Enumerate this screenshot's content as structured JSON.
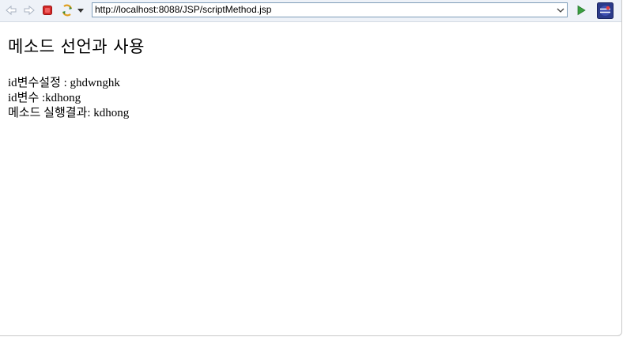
{
  "toolbar": {
    "back_icon": "back-arrow-icon",
    "forward_icon": "forward-arrow-icon",
    "stop_icon": "stop-icon",
    "refresh_icon": "refresh-icon",
    "go_icon": "go-play-icon",
    "browser_icon": "eclipse-browser-icon",
    "url": "http://localhost:8088/JSP/scriptMethod.jsp"
  },
  "page": {
    "title": "메소드 선언과 사용",
    "lines": [
      "id변수설정 : ghdwnghk",
      "id변수 :kdhong",
      "메소드 실행결과: kdhong"
    ]
  },
  "colors": {
    "toolbar_bg": "#eef2f8",
    "stop_red": "#d42a2a",
    "go_green": "#3aa040",
    "url_border": "#7f9db9"
  }
}
